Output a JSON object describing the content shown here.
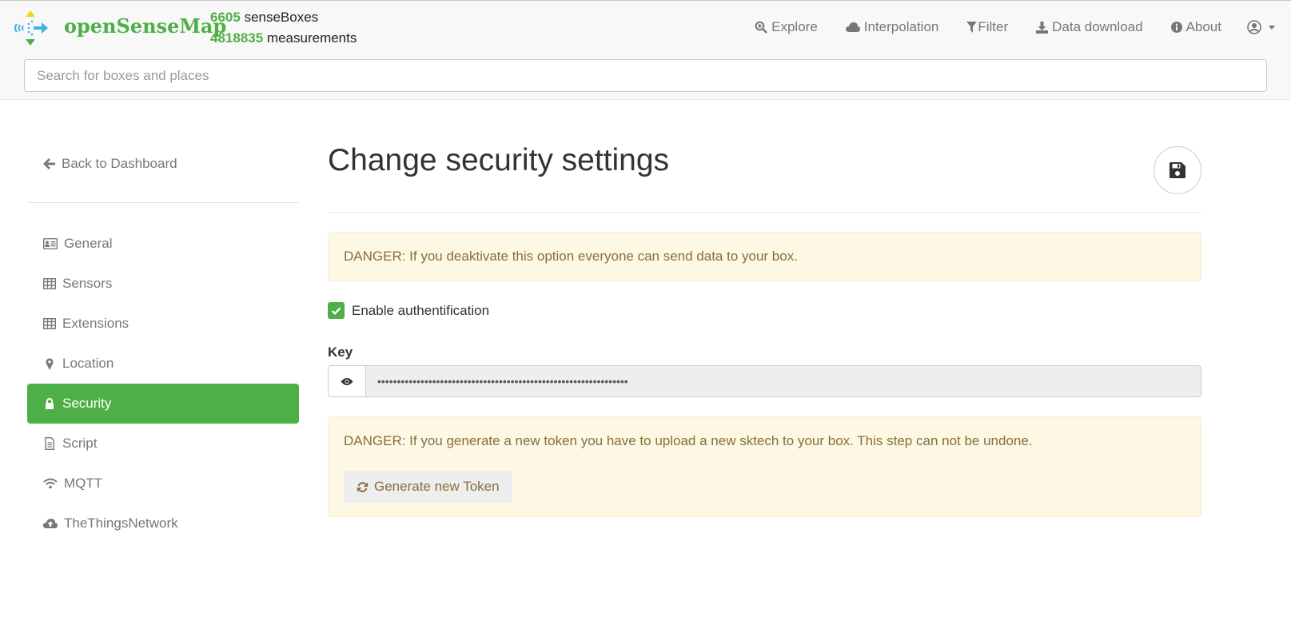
{
  "header": {
    "brand": "openSenseMap",
    "stats": {
      "boxes_count": "6605",
      "boxes_label": "senseBoxes",
      "measurements_count": "4818835",
      "measurements_label": "measurements"
    },
    "nav": [
      {
        "label": "Explore",
        "icon": "search-plus-icon"
      },
      {
        "label": "Interpolation",
        "icon": "cloud-icon"
      },
      {
        "label": "Filter",
        "icon": "filter-icon"
      },
      {
        "label": "Data download",
        "icon": "download-icon"
      },
      {
        "label": "About",
        "icon": "info-icon"
      }
    ],
    "user_icon": "user-circle-icon"
  },
  "search": {
    "placeholder": "Search for boxes and places",
    "value": ""
  },
  "sidebar": {
    "back": "Back to Dashboard",
    "items": [
      {
        "label": "General",
        "icon": "id-card-icon"
      },
      {
        "label": "Sensors",
        "icon": "table-icon"
      },
      {
        "label": "Extensions",
        "icon": "table-icon"
      },
      {
        "label": "Location",
        "icon": "map-marker-icon"
      },
      {
        "label": "Security",
        "icon": "lock-icon",
        "active": true
      },
      {
        "label": "Script",
        "icon": "file-text-icon"
      },
      {
        "label": "MQTT",
        "icon": "wifi-icon"
      },
      {
        "label": "TheThingsNetwork",
        "icon": "cloud-upload-icon"
      }
    ]
  },
  "main": {
    "title": "Change security settings",
    "alert_auth": "DANGER: If you deaktivate this option everyone can send data to your box.",
    "enable_auth_label": "Enable authentification",
    "enable_auth_checked": true,
    "key_label": "Key",
    "key_value": "••••••••••••••••••••••••••••••••••••••••••••••••••••••••••••••••",
    "alert_token": "DANGER: If you generate a new token you have to upload a new sktech to your box. This step can not be undone.",
    "generate_button": "Generate new Token"
  },
  "colors": {
    "brand": "#4eaf47",
    "warning_bg": "#fcf8e3",
    "warning_text": "#8a6d3b"
  }
}
